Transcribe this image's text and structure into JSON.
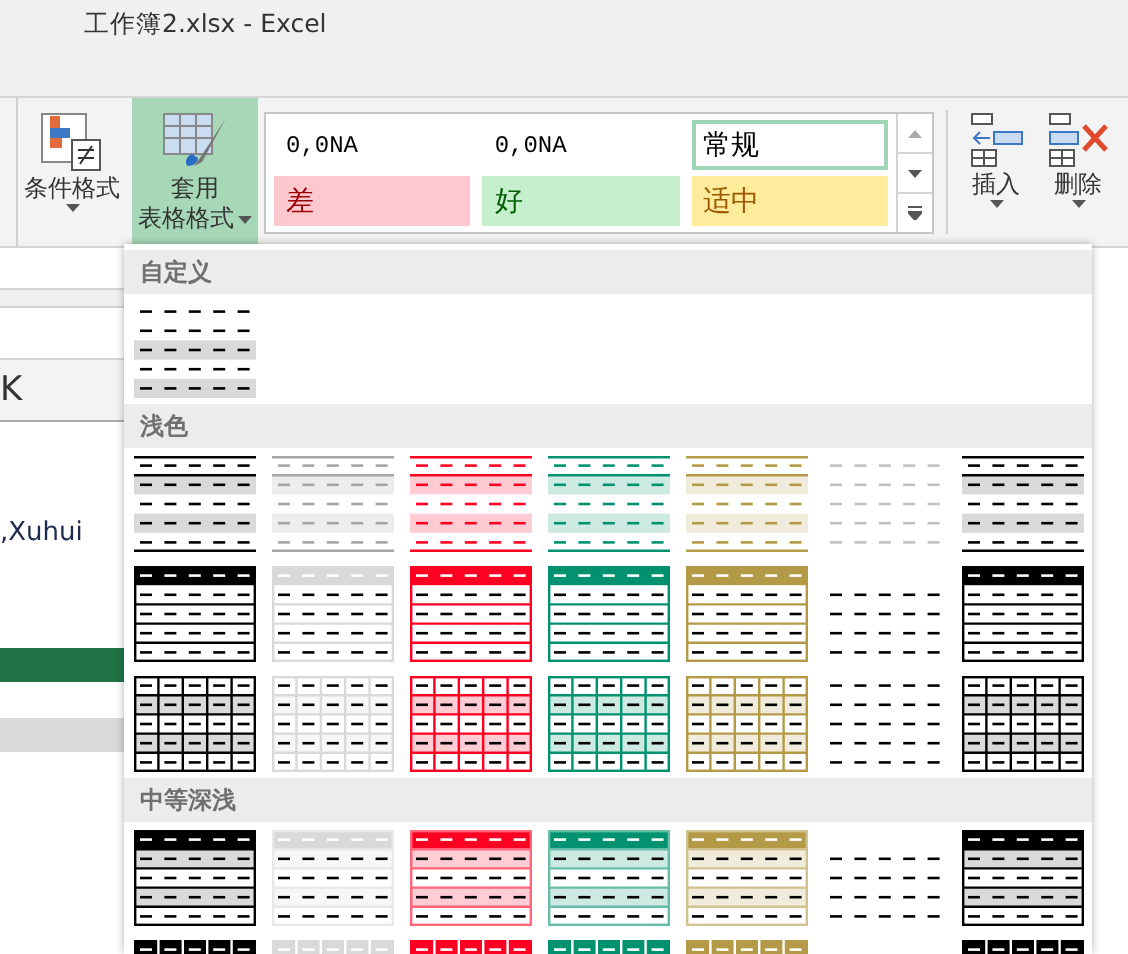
{
  "window": {
    "title": "工作簿2.xlsx - Excel"
  },
  "ribbon": {
    "buttons": [
      {
        "kind": "conditional",
        "lines": [
          "条件格式"
        ],
        "selected": false
      },
      {
        "kind": "table",
        "lines": [
          "套用",
          "表格格式"
        ],
        "selected": true
      }
    ],
    "cell_styles": [
      {
        "kind": "number",
        "label": "0,0NA",
        "selected": false
      },
      {
        "kind": "number",
        "label": "0,0NA",
        "selected": false
      },
      {
        "kind": "normal",
        "label": "常规",
        "selected": true
      },
      {
        "kind": "bad",
        "label": "差",
        "selected": false
      },
      {
        "kind": "good",
        "label": "好",
        "selected": false
      },
      {
        "kind": "neutral",
        "label": "适中",
        "selected": false
      }
    ],
    "cell_buttons": [
      {
        "kind": "insert",
        "label": "插入"
      },
      {
        "kind": "delete",
        "label": "删除"
      }
    ]
  },
  "sheet": {
    "column_header": "K",
    "cell_text": ",Xuhui"
  },
  "gallery": {
    "sections": [
      {
        "title": "自定义",
        "rows": [
          [
            {
              "kind": "custom",
              "color": "#000000"
            }
          ]
        ]
      },
      {
        "title": "浅色",
        "rows": [
          [
            {
              "kind": "banded",
              "color": "#000000"
            },
            {
              "kind": "banded",
              "color": "#a6a6a6"
            },
            {
              "kind": "banded",
              "color": "#ff0022"
            },
            {
              "kind": "banded",
              "color": "#009270"
            },
            {
              "kind": "banded",
              "color": "#b49a46"
            },
            {
              "kind": "plain",
              "color": "#c0c0c0"
            },
            {
              "kind": "banded",
              "color": "#000000"
            }
          ],
          [
            {
              "kind": "header-lines",
              "color": "#000000"
            },
            {
              "kind": "header-lines",
              "color": "#d9d9d9"
            },
            {
              "kind": "header-lines",
              "color": "#ff0022"
            },
            {
              "kind": "header-lines",
              "color": "#009270"
            },
            {
              "kind": "header-lines",
              "color": "#b49a46"
            },
            {
              "kind": "plain-body",
              "color": "#000000"
            },
            {
              "kind": "header-lines",
              "color": "#000000"
            }
          ],
          [
            {
              "kind": "grid",
              "color": "#000000"
            },
            {
              "kind": "grid",
              "color": "#d9d9d9"
            },
            {
              "kind": "grid",
              "color": "#ff0022"
            },
            {
              "kind": "grid",
              "color": "#009270"
            },
            {
              "kind": "grid",
              "color": "#b49a46"
            },
            {
              "kind": "plain",
              "color": "#000000"
            },
            {
              "kind": "grid",
              "color": "#000000"
            }
          ]
        ]
      },
      {
        "title": "中等深浅",
        "rows": [
          [
            {
              "kind": "medium-banded",
              "color": "#000000"
            },
            {
              "kind": "medium-banded",
              "color": "#d9d9d9"
            },
            {
              "kind": "medium-banded",
              "color": "#ff0022"
            },
            {
              "kind": "medium-banded",
              "color": "#009270"
            },
            {
              "kind": "medium-banded",
              "color": "#b49a46"
            },
            {
              "kind": "plain-body",
              "color": "#000000"
            },
            {
              "kind": "medium-banded",
              "color": "#000000"
            }
          ],
          [
            {
              "kind": "medium-grid",
              "color": "#000000"
            },
            {
              "kind": "medium-grid",
              "color": "#d9d9d9"
            },
            {
              "kind": "medium-grid",
              "color": "#ff0022"
            },
            {
              "kind": "medium-grid",
              "color": "#009270"
            },
            {
              "kind": "medium-grid",
              "color": "#b49a46"
            },
            {
              "kind": "blank"
            },
            {
              "kind": "medium-grid",
              "color": "#000000"
            }
          ]
        ]
      }
    ]
  }
}
